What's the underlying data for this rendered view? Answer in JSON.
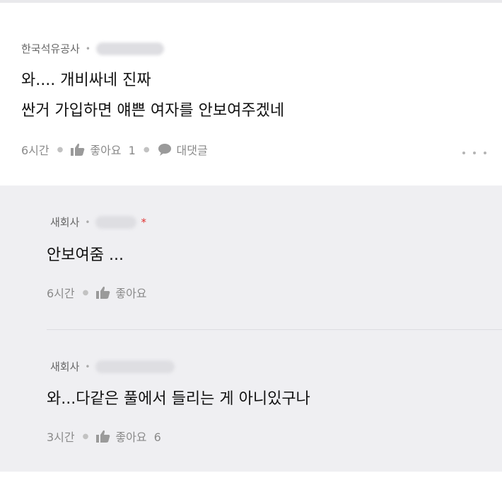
{
  "top_comment": {
    "author": "한국석유공사",
    "lines": [
      "와.... 개비싸네 진짜",
      "싼거 가입하면 얘쁜 여자를 안보여주겠네"
    ],
    "time": "6시간",
    "like_label": "좋아요",
    "like_count": "1",
    "reply_label": "대댓글"
  },
  "replies": [
    {
      "author": "새회사",
      "text": "안보여줌 ...",
      "time": "6시간",
      "like_label": "좋아요",
      "like_count": "",
      "star": "*"
    },
    {
      "author": "새회사",
      "text": "와...다같은 풀에서 들리는 게 아니있구나",
      "time": "3시간",
      "like_label": "좋아요",
      "like_count": "6"
    }
  ],
  "icons": {
    "like": "thumbs-up-icon",
    "reply": "speech-bubble-icon",
    "more": "more-horizontal-icon"
  },
  "colors": {
    "reply_background": "#efeff2",
    "star": "#e03434",
    "meta_text": "#8a8a8a"
  }
}
